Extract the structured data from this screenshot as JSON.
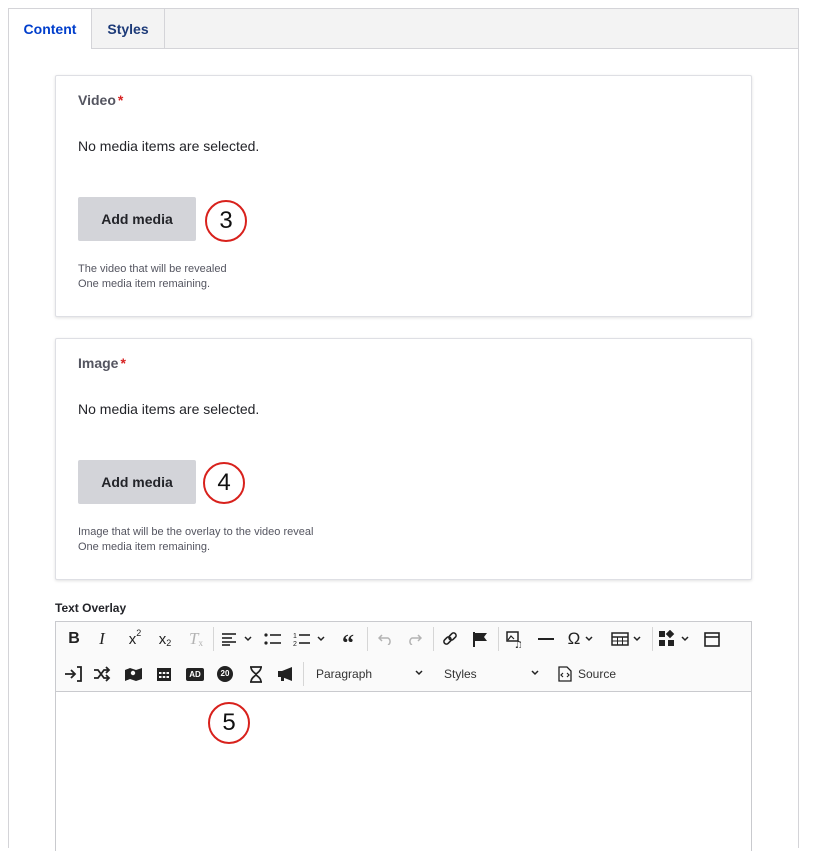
{
  "tabs": [
    {
      "label": "Content",
      "active": true
    },
    {
      "label": "Styles",
      "active": false
    }
  ],
  "video": {
    "label": "Video",
    "required_mark": "*",
    "empty_text": "No media items are selected.",
    "button": "Add media",
    "desc1": "The video that will be revealed",
    "desc2": "One media item remaining."
  },
  "image": {
    "label": "Image",
    "required_mark": "*",
    "empty_text": "No media items are selected.",
    "button": "Add media",
    "desc1": "Image that will be the overlay to the video reveal",
    "desc2": "One media item remaining."
  },
  "markers": [
    "3",
    "4",
    "5"
  ],
  "text_overlay": {
    "label": "Text Overlay",
    "paragraph": "Paragraph",
    "styles": "Styles",
    "source": "Source",
    "ad_badge": "AD",
    "timer_badge": "20"
  },
  "colors": {
    "accent": "#003ecc",
    "required": "#d72222",
    "marker": "#d8211c"
  }
}
